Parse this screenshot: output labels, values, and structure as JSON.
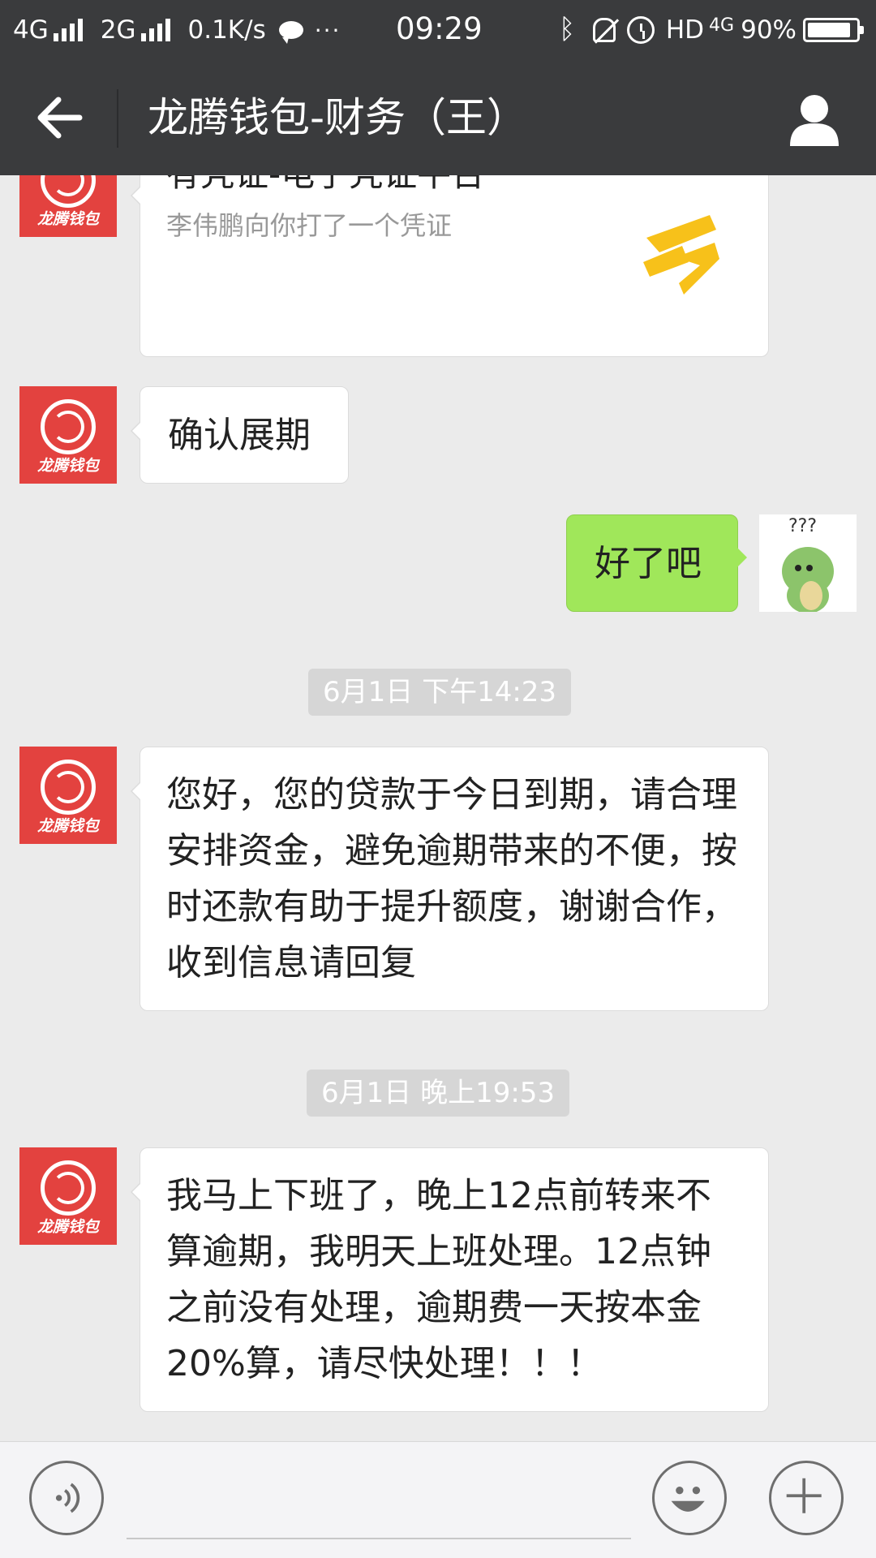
{
  "status_bar": {
    "network1": "4G",
    "network2": "2G",
    "speed": "0.1K/s",
    "more": "···",
    "time": "09:29",
    "hd": "HD",
    "network3": "4G",
    "battery_percent": "90%",
    "battery_level": 0.9
  },
  "header": {
    "title": "龙腾钱包-财务（王）"
  },
  "avatar_logo_text": "龙腾钱包",
  "messages": {
    "card": {
      "title": "有凭证-电子凭证平台",
      "subtitle": "李伟鹏向你打了一个凭证"
    },
    "m1": "确认展期",
    "m2": "好了吧",
    "sticker_text": "???",
    "t1": "6月1日 下午14:23",
    "m3": "您好，您的贷款于今日到期，请合理安排资金，避免逾期带来的不便，按时还款有助于提升额度，谢谢合作，收到信息请回复",
    "t2": "6月1日 晚上19:53",
    "m4": "我马上下班了，晚上12点前转来不算逾期，我明天上班处理。12点钟之前没有处理，逾期费一天按本金20%算，请尽快处理！！！"
  },
  "colors": {
    "bar": "#3a3b3d",
    "chat_bg": "#ebebeb",
    "sent_bubble": "#a0e75a",
    "avatar_red": "#e3423f",
    "s_logo_yellow": "#f7c11a"
  }
}
